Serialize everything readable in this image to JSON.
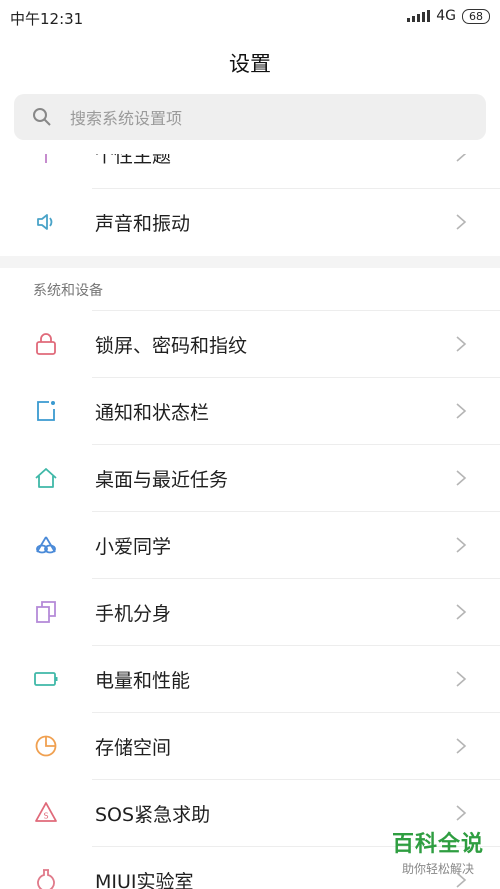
{
  "status_bar": {
    "time": "中午12:31",
    "network": "4G",
    "battery": "68"
  },
  "header": {
    "title": "设置"
  },
  "search": {
    "placeholder": "搜索系统设置项"
  },
  "section_system": "系统和设备",
  "items": [
    {
      "label": "个性主题",
      "icon": "theme-icon",
      "color": "#c080c8"
    },
    {
      "label": "声音和振动",
      "icon": "speaker-icon",
      "color": "#4aa3c8"
    },
    {
      "label": "锁屏、密码和指纹",
      "icon": "lock-icon",
      "color": "#e06a7a"
    },
    {
      "label": "通知和状态栏",
      "icon": "notification-icon",
      "color": "#3a9ad0"
    },
    {
      "label": "桌面与最近任务",
      "icon": "home-icon",
      "color": "#3fb8a8"
    },
    {
      "label": "小爱同学",
      "icon": "xiaoai-icon",
      "color": "#4a8ad8"
    },
    {
      "label": "手机分身",
      "icon": "dual-phone-icon",
      "color": "#b58ad8"
    },
    {
      "label": "电量和性能",
      "icon": "battery-icon",
      "color": "#3fb8a8"
    },
    {
      "label": "存储空间",
      "icon": "storage-pie-icon",
      "color": "#f0a050"
    },
    {
      "label": "SOS紧急求助",
      "icon": "sos-icon",
      "color": "#e06a7a"
    },
    {
      "label": "MIUI实验室",
      "icon": "lab-flask-icon",
      "color": "#e07a8a"
    }
  ],
  "watermark": {
    "title": "百科全说",
    "subtitle": "助你轻松解决"
  }
}
